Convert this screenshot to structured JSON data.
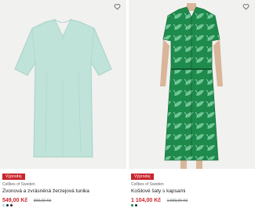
{
  "products": [
    {
      "badge": "Výprodej",
      "brand": "Cellbes of Sweden",
      "title": "Zvonová a zvrásněná žerzejová tunika",
      "price": "549,00 Kč",
      "old_price": "999,00 Kč",
      "swatch_colors": [
        "#a8dcd2",
        "#1f2a44",
        "#2b2b2b"
      ],
      "image_color": "#bfe2d9"
    },
    {
      "badge": "Výprodej",
      "brand": "Cellbes of Sweden",
      "title": "Košilové šaty s kapsami",
      "price": "1 104,00 Kč",
      "old_price": "1 699,00 Kč",
      "swatch_colors": [
        "#1a8a4a",
        "#1f2a44"
      ],
      "image_color": "#1e8a4c"
    }
  ],
  "colors": {
    "sale_red": "#c9252c"
  },
  "icons": {
    "favorite": "heart-outline-icon"
  }
}
